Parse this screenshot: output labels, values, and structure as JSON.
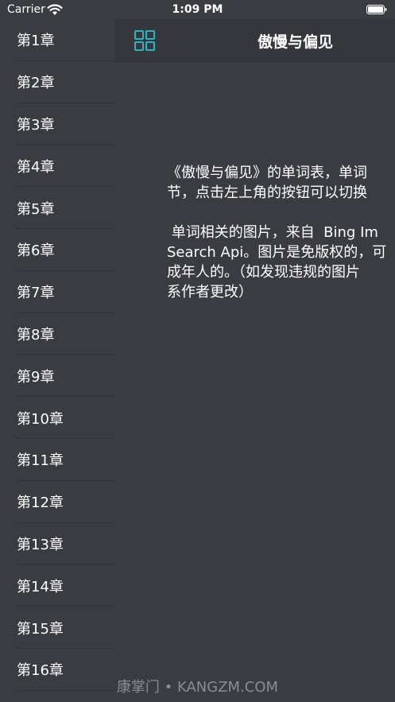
{
  "status_bar": {
    "carrier": "Carrier",
    "time": "1:09 PM"
  },
  "sidebar": {
    "chapters": [
      {
        "label": "第1章"
      },
      {
        "label": "第2章"
      },
      {
        "label": "第3章"
      },
      {
        "label": "第4章"
      },
      {
        "label": "第5章"
      },
      {
        "label": "第6章"
      },
      {
        "label": "第7章"
      },
      {
        "label": "第8章"
      },
      {
        "label": "第9章"
      },
      {
        "label": "第10章"
      },
      {
        "label": "第11章"
      },
      {
        "label": "第12章"
      },
      {
        "label": "第13章"
      },
      {
        "label": "第14章"
      },
      {
        "label": "第15章"
      },
      {
        "label": "第16章"
      }
    ]
  },
  "nav": {
    "title": "傲慢与偏见",
    "accent_color": "#2bb3c0",
    "menu_icon": "grid-icon"
  },
  "content": {
    "line1": "《傲慢与偏见》的单词表，单词",
    "line2": "节，点击左上角的按钮可以切换",
    "line3": " 单词相关的图片，来自  Bing Im",
    "line4": "Search Api。图片是免版权的，可",
    "line5": "成年人的。（如发现违规的图片",
    "line6": "系作者更改）"
  },
  "watermark": "康掌门 • KANGZM.COM"
}
